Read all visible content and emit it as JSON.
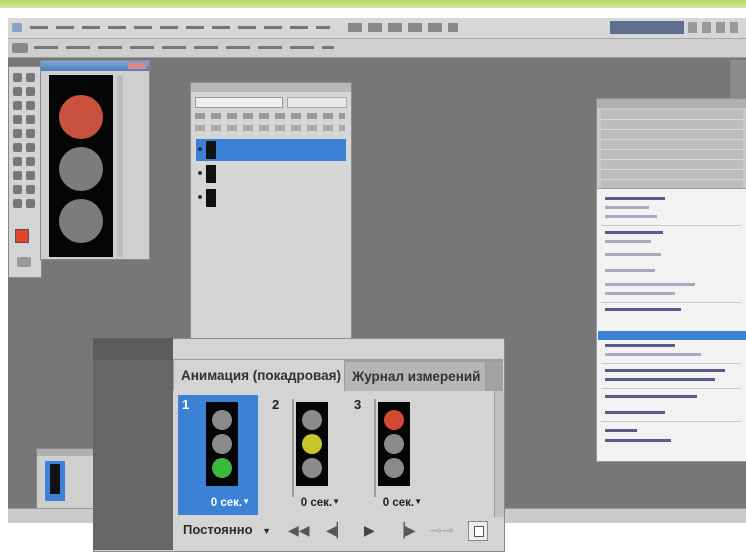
{
  "animation_panel": {
    "tab_active": "Анимация (покадровая)",
    "tab_inactive": "Журнал измерений",
    "frames": [
      {
        "number": "1",
        "delay": "0 сек.",
        "delay_arrow": "▼",
        "selected": true,
        "lit": "green",
        "lit_color": "#3cb83a"
      },
      {
        "number": "2",
        "delay": "0 сек.",
        "delay_arrow": "▼",
        "selected": false,
        "lit": "yellow",
        "lit_color": "#c9c62a"
      },
      {
        "number": "3",
        "delay": "0 сек.",
        "delay_arrow": "▼",
        "selected": false,
        "lit": "red",
        "lit_color": "#d24a35"
      }
    ],
    "loop_option": "Постоянно",
    "loop_arrow": "▼"
  },
  "document": {
    "lit": "red",
    "lit_color": "#c9523e",
    "unlit_color": "#7c7c7c"
  },
  "colors": {
    "selection_blue": "#3b82d6",
    "workspace": "#777777",
    "panel": "#d4d4d4"
  },
  "icons": {
    "first_frame": "first-frame-icon",
    "prev_frame": "prev-frame-icon",
    "play": "play-icon",
    "next_frame": "next-frame-icon",
    "tween": "tween-icon",
    "new_frame": "new-frame-icon"
  }
}
